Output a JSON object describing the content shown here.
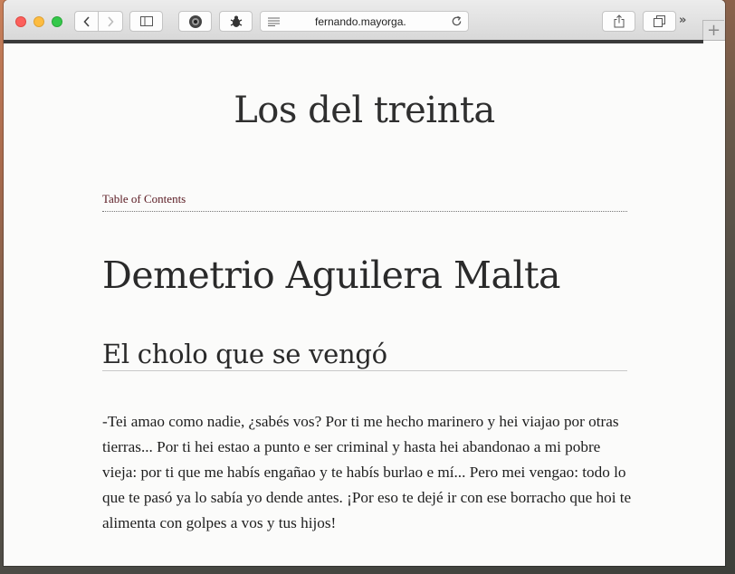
{
  "browser": {
    "url": "fernando.mayorga."
  },
  "page": {
    "site_title": "Los del treinta",
    "toc_link": "Table of Contents",
    "author": "Demetrio Aguilera Malta",
    "story_title": "El cholo que se vengó",
    "paragraph": "-Tei amao como nadie, ¿sabés vos? Por ti me hecho marinero y hei viajao por otras tierras... Por ti hei estao a punto e ser criminal y hasta hei abandonao a mi pobre vieja: por ti que me habís engañao y te habís burlao e mí... Pero mei vengao: todo lo que te pasó ya lo sabía yo dende antes. ¡Por eso te dejé ir con ese borracho que hoi te alimenta con golpes a vos y tus hijos!"
  },
  "colors": {
    "link": "#5a1a22",
    "text": "#2a2a2a"
  }
}
